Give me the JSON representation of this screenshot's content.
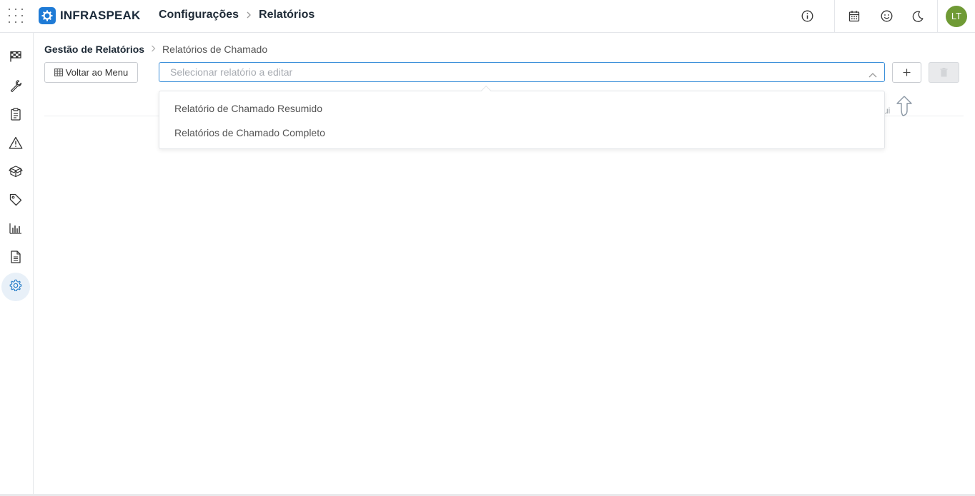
{
  "app": {
    "brand": "INFRASPEAK",
    "brand_color": "#1f7bd6"
  },
  "header": {
    "crumbs": [
      "Configurações",
      "Relatórios"
    ],
    "icons": [
      "info-icon",
      "calendar-icon",
      "smiley-icon",
      "moon-icon"
    ],
    "avatar_initials": "LT",
    "avatar_color": "#6f9a35"
  },
  "sidebar": {
    "items": [
      {
        "icon": "flag-icon",
        "active": false
      },
      {
        "icon": "wrench-icon",
        "active": false
      },
      {
        "icon": "clipboard-icon",
        "active": false
      },
      {
        "icon": "warning-icon",
        "active": false
      },
      {
        "icon": "box-icon",
        "active": false
      },
      {
        "icon": "tag-icon",
        "active": false
      },
      {
        "icon": "bar-chart-icon",
        "active": false
      },
      {
        "icon": "document-icon",
        "active": false
      },
      {
        "icon": "gear-icon",
        "active": true
      }
    ]
  },
  "breadcrumb": {
    "root": "Gestão de Relatórios",
    "current": "Relatórios de Chamado"
  },
  "toolbar": {
    "back_label": "Voltar ao Menu",
    "select_placeholder": "Selecionar relatório a editar",
    "add_label": "+"
  },
  "dropdown": {
    "options": [
      "Relatório de Chamado Resumido",
      "Relatórios de Chamado Completo"
    ]
  },
  "hint": {
    "text": "ui"
  }
}
